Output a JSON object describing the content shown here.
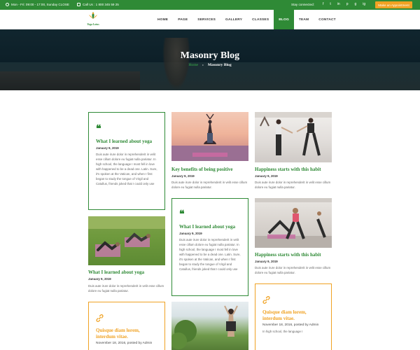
{
  "topbar": {
    "hours": "Mon - Fri: 09:00 - 17:00, Sunday CLOSE",
    "phone": "Call Us : 1 800 345 59 25",
    "stay_connected": "Stay connected:",
    "social": [
      "f",
      "t",
      "in",
      "p",
      "g",
      "ig"
    ],
    "appointment_label": "Make an Appointment"
  },
  "logo": {
    "text": "Yoga Lotus"
  },
  "nav": {
    "items": [
      "HOME",
      "PAGE",
      "SERVICES",
      "GALLERY",
      "CLASSES",
      "BLOG",
      "TEAM",
      "CONTACT"
    ],
    "active": "BLOG"
  },
  "hero": {
    "title": "Masonry Blog",
    "breadcrumb_home": "Home",
    "breadcrumb_sep": "›",
    "breadcrumb_current": "Masonry Blog"
  },
  "posts": {
    "quote1": {
      "icon": "quote-icon",
      "title": "What I learned about yoga",
      "date": "January 9, 2019",
      "excerpt": "Duis aute irure dolor in reprehenderit in velit esse cillum dolore eu fugiat nulla pariatur. In high school, the language I most fell in love with happened to be a dead one. Latin. Sure, it's spoken at the Vatican, and when I first began to study the tongue of Virgil and Catullus, friends joked that I could only use"
    },
    "sunset": {
      "title": "Key benefits of being positive",
      "date": "January 9, 2019",
      "excerpt": "Duis aute irure dolor in reprehenderit in velit esse cillum dolore eu fugiat nulla pariatur."
    },
    "happiness1": {
      "title": "Happiness starts with this habit",
      "date": "January 9, 2019",
      "excerpt": "Duis aute irure dolor in reprehenderit in velit esse cillum dolore eu fugiat nulla pariatur."
    },
    "quote2": {
      "icon": "quote-icon",
      "title": "What I learned about yoga",
      "date": "January 9, 2019",
      "excerpt": "Duis aute irure dolor in reprehenderit in velit esse cillum dolore eu fugiat nulla pariatur. In high school, the language I most fell in love with happened to be a dead one. Latin. Sure, it's spoken at the Vatican, and when I first began to study the tongue of Virgil and Catullus, friends joked that I could only use"
    },
    "grass": {
      "title": "What I learned about yoga",
      "date": "January 9, 2019",
      "excerpt": "Duis aute irure dolor in reprehenderit in velit esse cillum dolore eu fugiat nulla pariatur."
    },
    "happiness2": {
      "title": "Happiness starts with this habit",
      "date": "January 9, 2019",
      "excerpt": "Duis aute irure dolor in reprehenderit in velit esse cillum dolore eu fugiat nulla pariatur."
    },
    "link1": {
      "icon": "link-icon",
      "title": "Quisque diam lorem, interdum vitae.",
      "date": "November 18, 2016, posted by Admin"
    },
    "link2": {
      "icon": "link-icon",
      "title": "Quisque diam lorem, interdum vitae.",
      "date": "November 18, 2016, posted by Admin",
      "excerpt": "In high school, the language I"
    }
  },
  "colors": {
    "brand_green": "#2f8a36",
    "accent_orange": "#f0a223"
  }
}
